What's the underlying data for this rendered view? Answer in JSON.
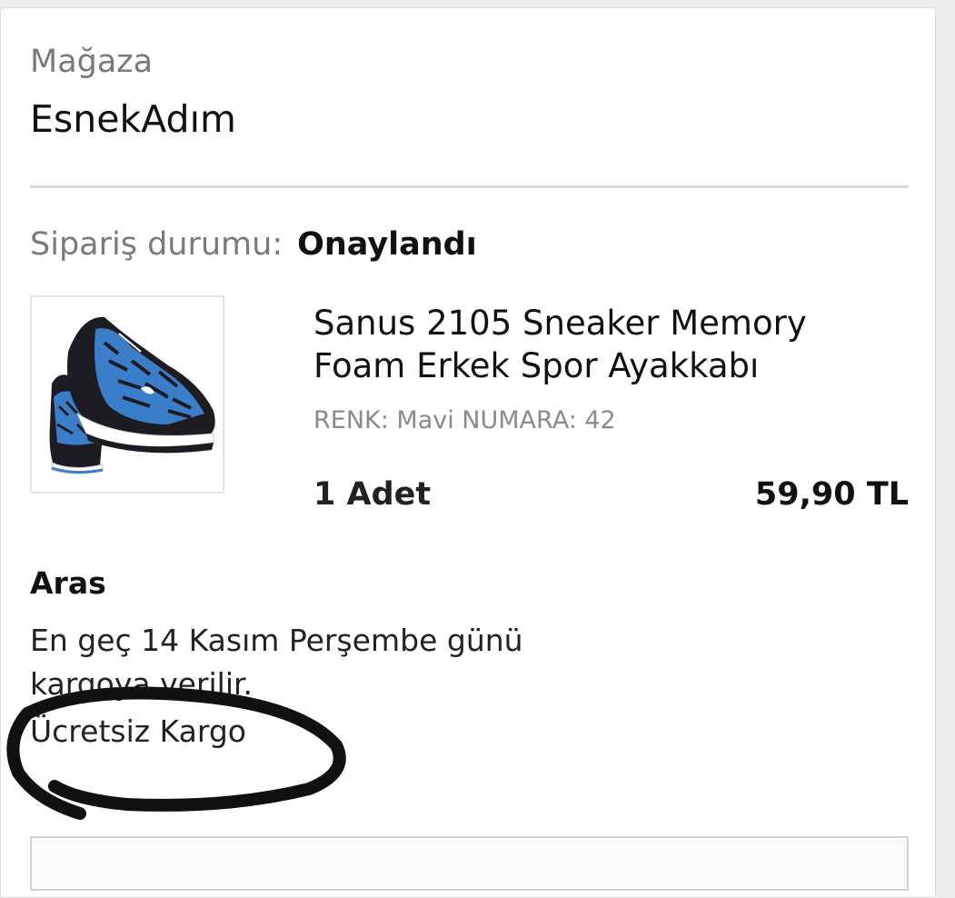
{
  "store": {
    "label": "Mağaza",
    "name": "EsnekAdım"
  },
  "order": {
    "status_label": "Sipariş durumu:",
    "status_value": "Onaylandı"
  },
  "product": {
    "image_icon": "sneaker-image",
    "title": "Sanus 2105  Sneaker Memory Foam Erkek Spor Ayakkabı",
    "variant": "RENK: Mavi NUMARA: 42",
    "quantity": "1 Adet",
    "price": "59,90 TL"
  },
  "shipping": {
    "carrier": "Aras",
    "line1": "En geç 14 Kasım Perşembe günü",
    "line2": "kargoya verilir.",
    "free": "Ücretsiz Kargo"
  },
  "colors": {
    "shoe_blue": "#3a7ec9",
    "shoe_black": "#1c1c22",
    "annotation": "#111111"
  }
}
